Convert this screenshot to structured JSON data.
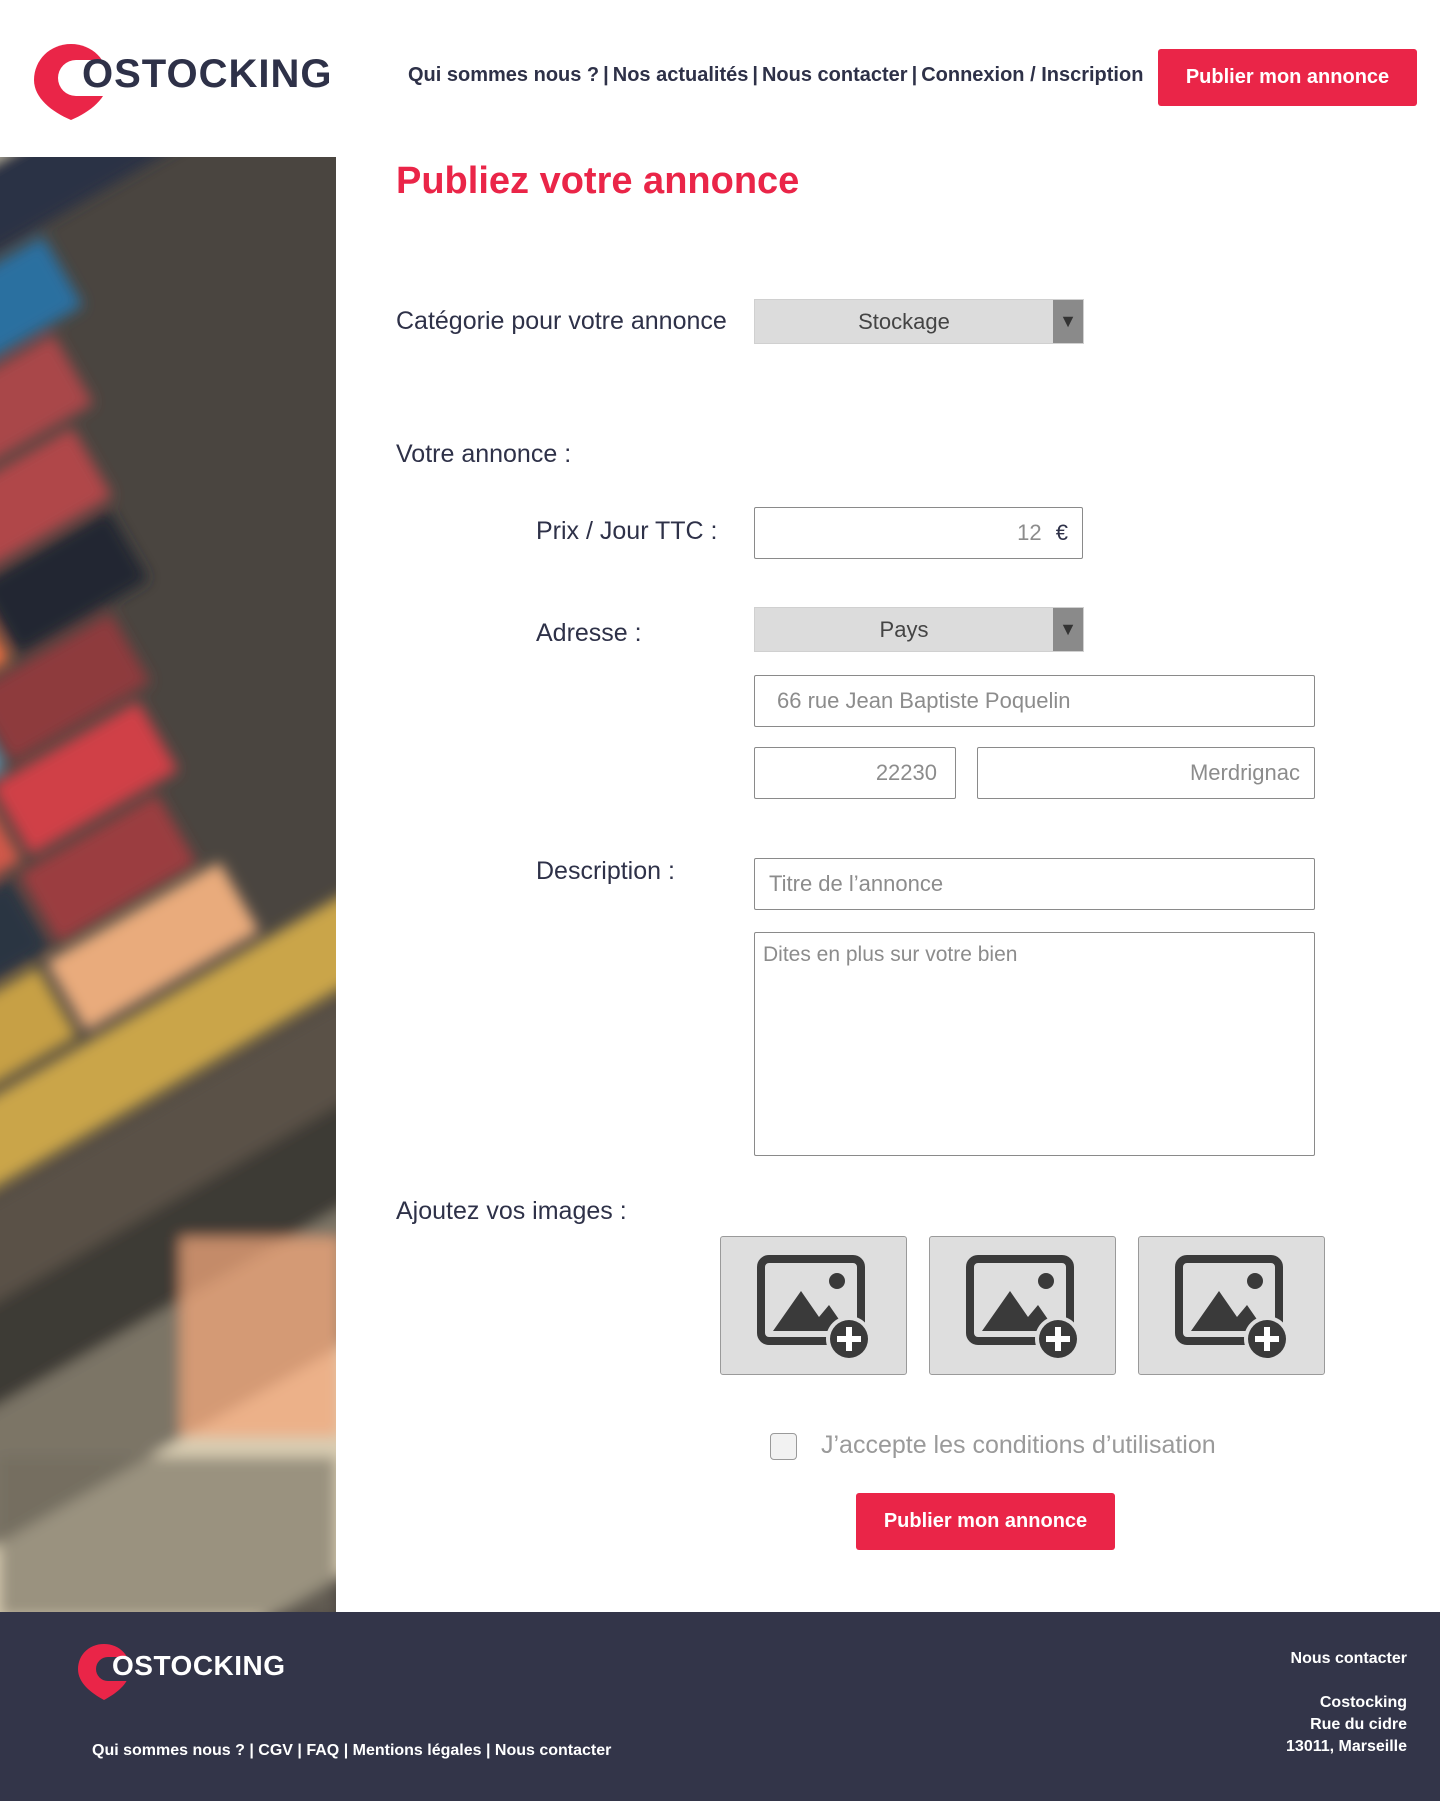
{
  "brand": {
    "name": "OSTOCKING",
    "accent_color": "#ea2548",
    "dark_color": "#2e3148",
    "footer_bg": "#333549"
  },
  "header": {
    "nav": [
      {
        "label": "Qui sommes nous ?"
      },
      {
        "label": "Nos actualités"
      },
      {
        "label": "Nous contacter"
      },
      {
        "label": "Connexion / Inscription"
      }
    ],
    "cta_label": "Publier mon annonce"
  },
  "side_image": {
    "description_icon": "shipping-containers-photo"
  },
  "form": {
    "title": "Publiez votre annonce",
    "category_label": "Catégorie pour votre annonce",
    "category_value": "Stockage",
    "annonce_label": "Votre annonce :",
    "price_label": "Prix / Jour TTC :",
    "price_value": "12",
    "price_currency": "€",
    "address_label": "Adresse :",
    "country_value": "Pays",
    "street_placeholder": "66 rue Jean Baptiste Poquelin",
    "postal_placeholder": "22230",
    "city_placeholder": "Merdrignac",
    "description_label": "Description :",
    "title_placeholder": "Titre de l’annonce",
    "body_placeholder": "Dites en plus sur votre bien",
    "images_label": "Ajoutez vos images :",
    "image_slots": [
      "add-image-icon",
      "add-image-icon",
      "add-image-icon"
    ],
    "terms_label": "J’accepte les conditions d’utilisation",
    "submit_label": "Publier mon annonce"
  },
  "footer": {
    "links": [
      {
        "label": "Qui sommes nous ?"
      },
      {
        "label": "CGV"
      },
      {
        "label": "FAQ"
      },
      {
        "label": "Mentions légales"
      },
      {
        "label": "Nous contacter"
      }
    ],
    "contact_title": "Nous contacter",
    "company": "Costocking",
    "street": "Rue du cidre",
    "city": "13011, Marseille"
  }
}
